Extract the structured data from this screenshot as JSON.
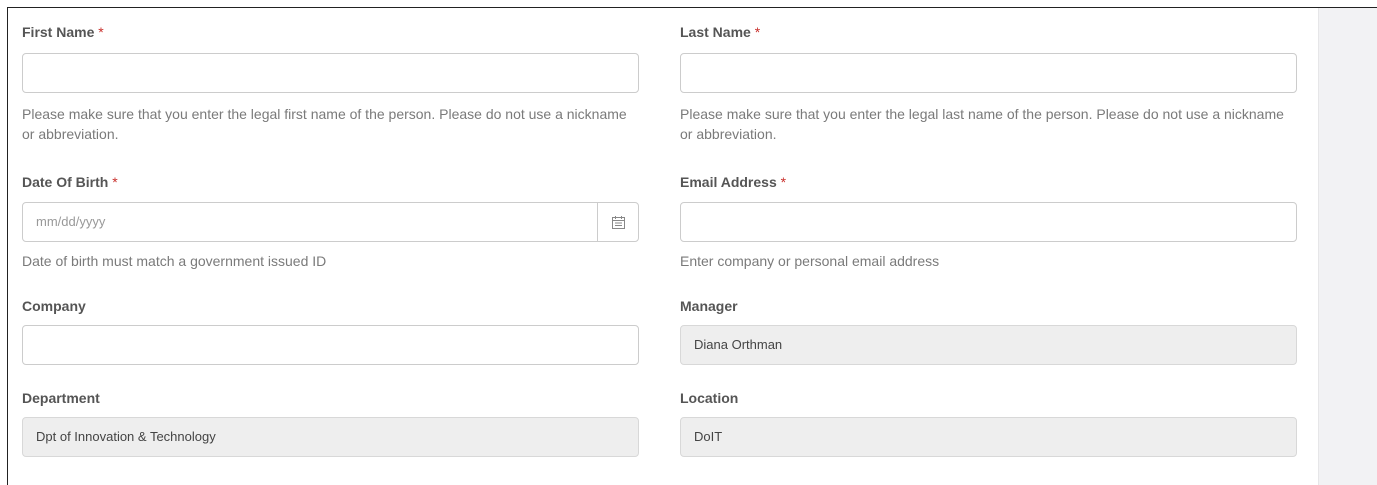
{
  "form": {
    "first_name": {
      "label": "First Name",
      "required_mark": "*",
      "value": "",
      "help": "Please make sure that you enter the legal first name of the person. Please do not use a nickname or abbreviation."
    },
    "last_name": {
      "label": "Last Name",
      "required_mark": "*",
      "value": "",
      "help": "Please make sure that you enter the legal last name of the person. Please do not use a nickname or abbreviation."
    },
    "date_of_birth": {
      "label": "Date Of Birth",
      "required_mark": "*",
      "placeholder": "mm/dd/yyyy",
      "help": "Date of birth must match a government issued ID",
      "icon": "calendar-icon"
    },
    "email": {
      "label": "Email Address",
      "required_mark": "*",
      "value": "",
      "help": "Enter company or personal email address"
    },
    "company": {
      "label": "Company",
      "value": ""
    },
    "manager": {
      "label": "Manager",
      "value": "Diana Orthman"
    },
    "department": {
      "label": "Department",
      "value": "Dpt of Innovation & Technology"
    },
    "location": {
      "label": "Location",
      "value": "DoIT"
    }
  },
  "colors": {
    "required": "#c9302c",
    "readonly_bg": "#eeeeee",
    "side_panel": "#f2f2f4"
  }
}
